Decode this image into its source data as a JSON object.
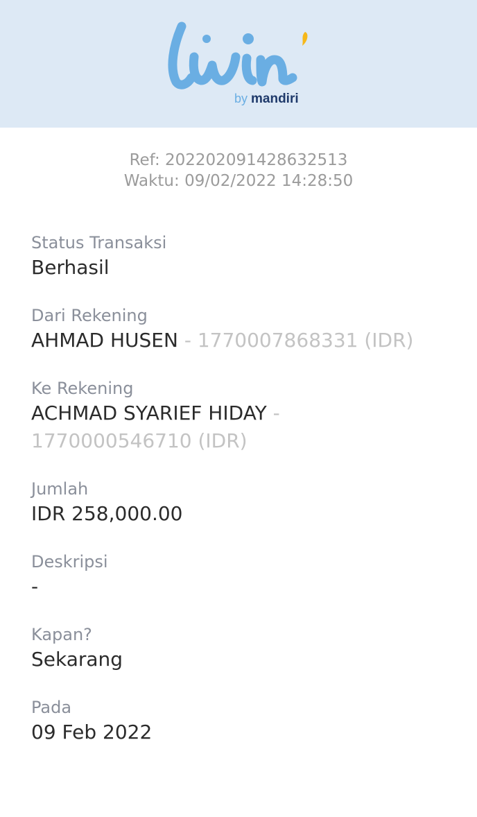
{
  "header": {
    "logo_text": "livin'",
    "logo_by": "by",
    "logo_brand": "mandiri"
  },
  "ref": {
    "ref_line": "Ref: 202202091428632513",
    "time_line": "Waktu: 09/02/2022 14:28:50"
  },
  "fields": {
    "status": {
      "label": "Status Transaksi",
      "value": "Berhasil"
    },
    "from": {
      "label": "Dari Rekening",
      "name": "AHMAD HUSEN",
      "account": " - 1770007868331 (IDR)"
    },
    "to": {
      "label": "Ke Rekening",
      "name": "ACHMAD SYARIEF HIDAY",
      "account": " - 1770000546710 (IDR)"
    },
    "amount": {
      "label": "Jumlah",
      "value": "IDR 258,000.00"
    },
    "description": {
      "label": "Deskripsi",
      "value": "-"
    },
    "when": {
      "label": "Kapan?",
      "value": "Sekarang"
    },
    "date": {
      "label": "Pada",
      "value": "09 Feb 2022"
    }
  },
  "colors": {
    "header_bg": "#dde9f5",
    "logo_blue": "#6aaee3",
    "logo_navy": "#1f3a6b",
    "logo_accent": "#f6b81a"
  }
}
